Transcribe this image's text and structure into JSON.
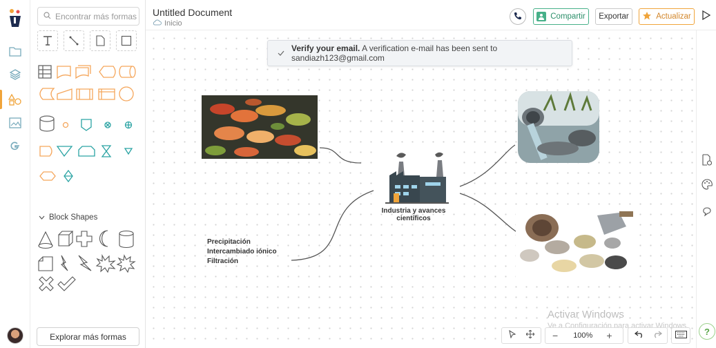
{
  "header": {
    "doc_title": "Untitled Document",
    "breadcrumb": "Inicio",
    "share_label": "Compartir",
    "export_label": "Exportar",
    "upgrade_label": "Actualizar"
  },
  "sidebar": {
    "search_placeholder": "Encontrar más formas",
    "block_section_title": "Block Shapes",
    "explore_label": "Explorar más formas"
  },
  "banner": {
    "title": "Verify your email.",
    "message": "A verification e-mail has been sent to sandiazh123@gmail.com"
  },
  "diagram": {
    "central_label": "Industria y avances científicos",
    "notes": [
      "Precipitación",
      "Intercambiado iónico",
      "Filtración"
    ]
  },
  "zoom": {
    "level": "100%"
  },
  "watermark": {
    "line1": "Activar Windows",
    "line2": "Ve a Configuración para activar Windows."
  },
  "colors": {
    "accent_orange": "#f0a43a",
    "accent_green": "#47b089",
    "shape_orange": "#f5a65b",
    "shape_teal": "#2aa3a3"
  }
}
